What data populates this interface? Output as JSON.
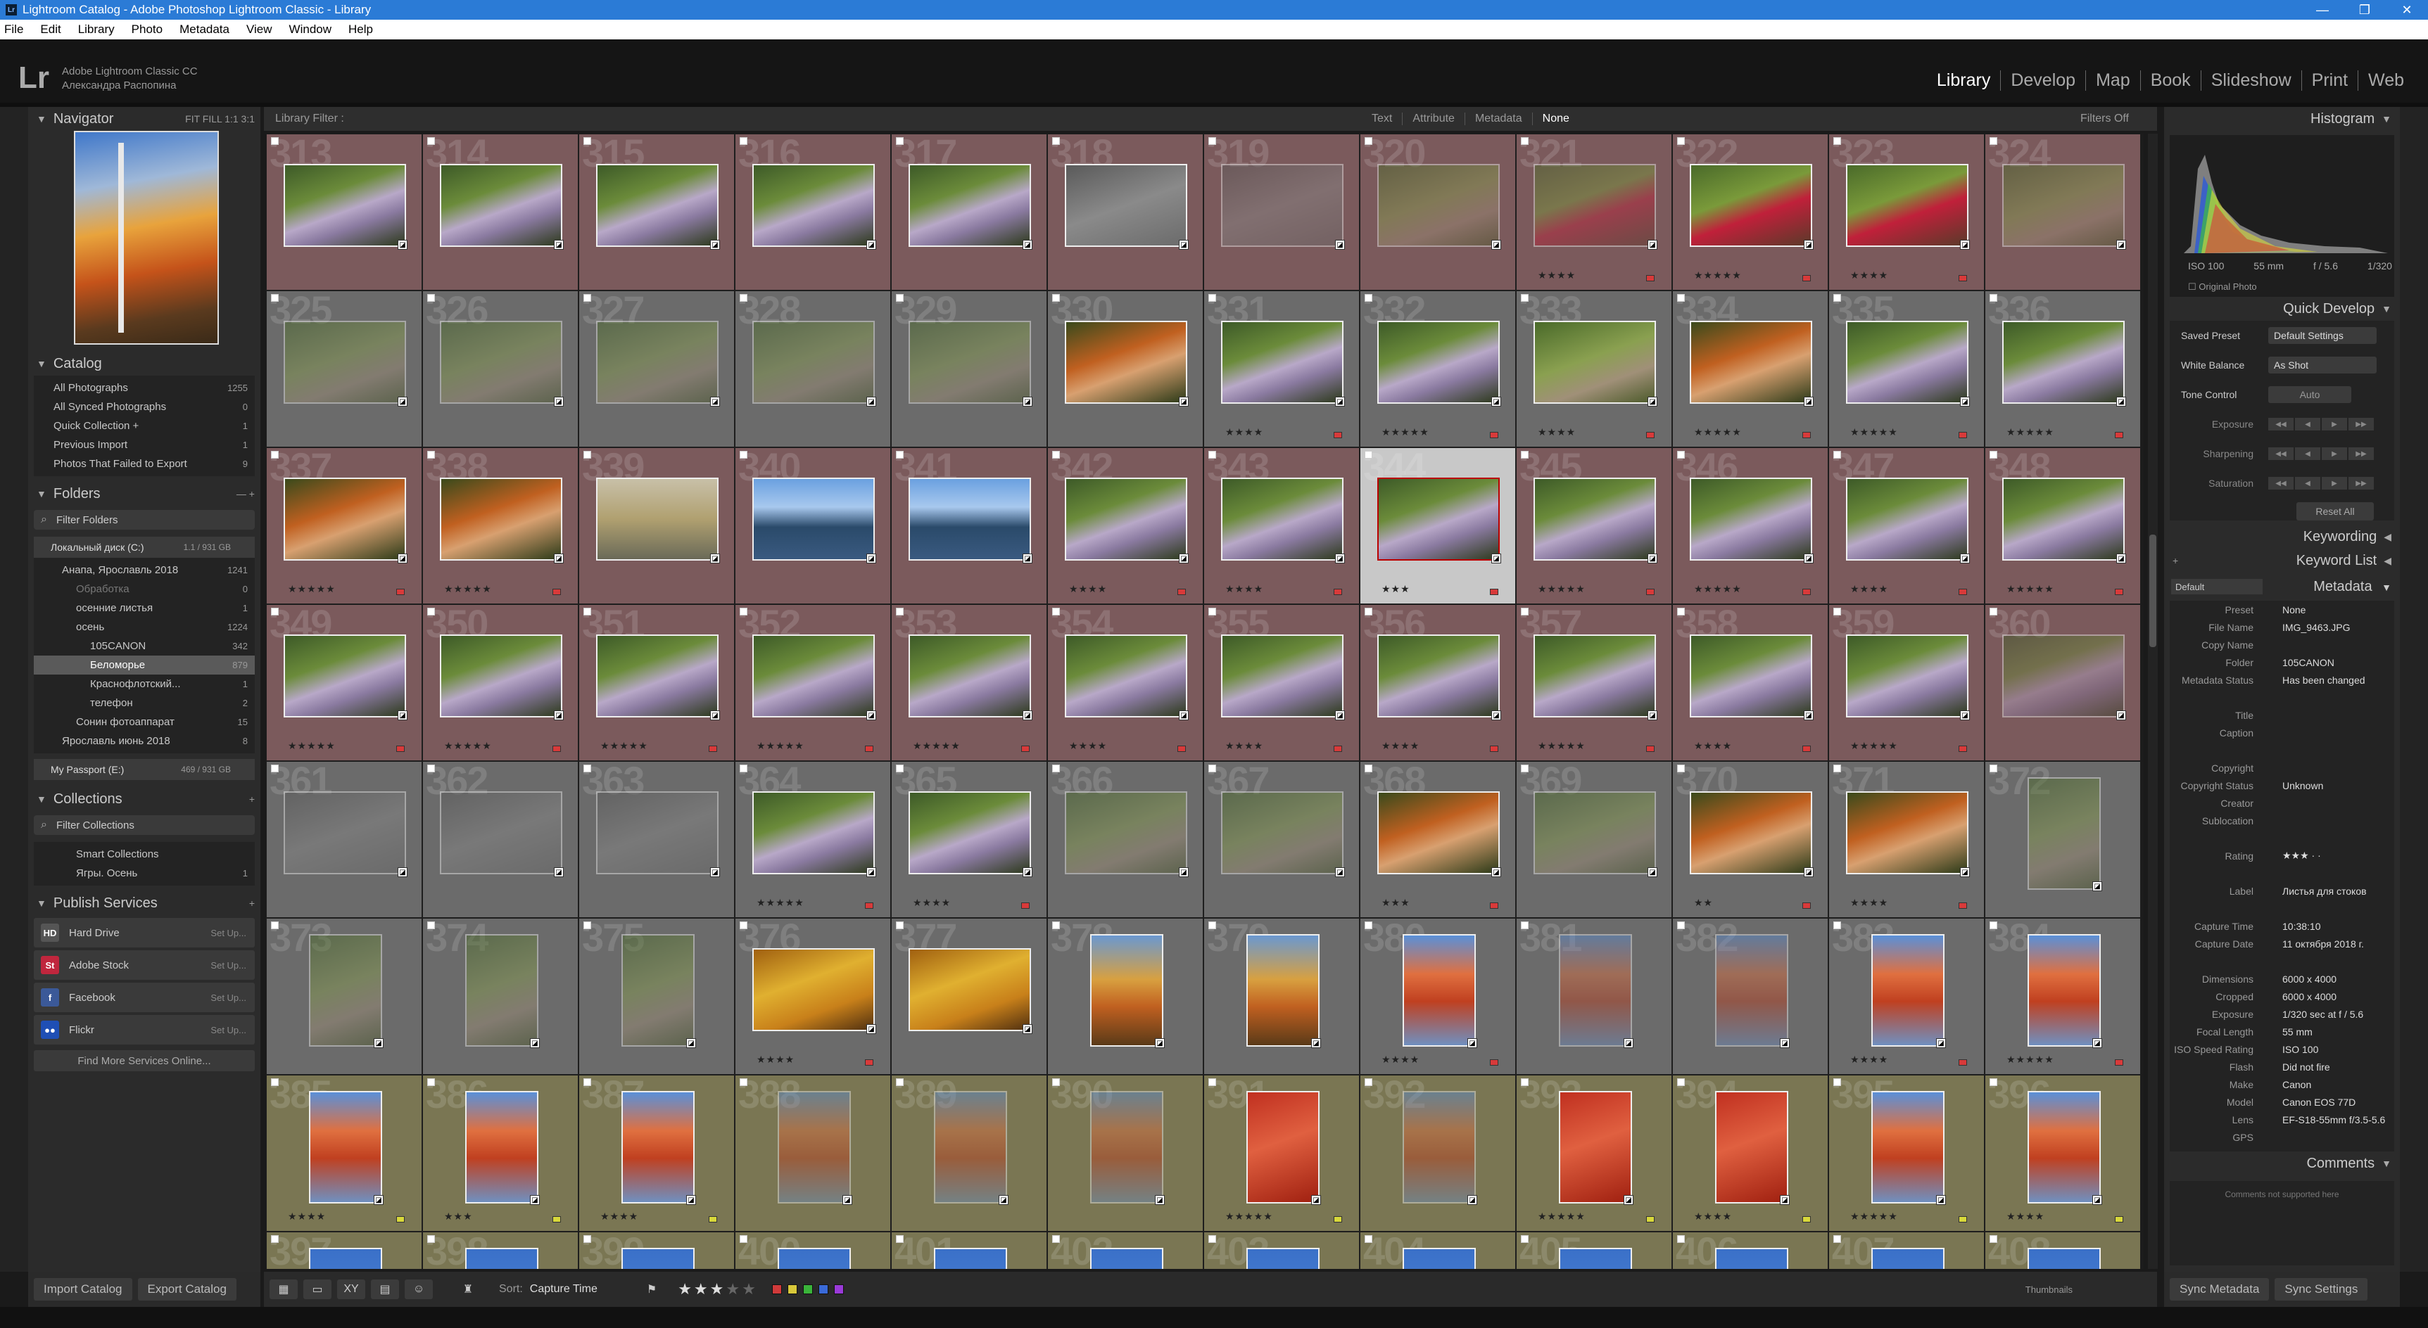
{
  "window": {
    "title": "Lightroom Catalog - Adobe Photoshop Lightroom Classic - Library"
  },
  "menu": [
    "File",
    "Edit",
    "Library",
    "Photo",
    "Metadata",
    "View",
    "Window",
    "Help"
  ],
  "identity": {
    "logo": "Lr",
    "product": "Adobe Lightroom Classic CC",
    "user": "Александра Распопина"
  },
  "modules": [
    "Library",
    "Develop",
    "Map",
    "Book",
    "Slideshow",
    "Print",
    "Web"
  ],
  "navigator": {
    "title": "Navigator",
    "zoom": "FIT  FILL  1:1  3:1"
  },
  "catalog": {
    "title": "Catalog",
    "items": [
      {
        "label": "All Photographs",
        "count": "1255"
      },
      {
        "label": "All Synced Photographs",
        "count": "0"
      },
      {
        "label": "Quick Collection +",
        "count": "1"
      },
      {
        "label": "Previous Import",
        "count": "1"
      },
      {
        "label": "Photos That Failed to Export",
        "count": "9"
      }
    ]
  },
  "folders": {
    "title": "Folders",
    "filter": "Filter Folders",
    "volume": {
      "label": "Локальный диск (C:)",
      "count": "1.1 / 931 GB"
    },
    "items": [
      {
        "label": "Анапа, Ярославль 2018",
        "count": "1241"
      },
      {
        "label": "Обработка",
        "count": "0"
      },
      {
        "label": "осенние листья",
        "count": "1"
      },
      {
        "label": "осень",
        "count": "1224"
      },
      {
        "label": "105CANON",
        "count": "342"
      },
      {
        "label": "Беломорье",
        "count": "879"
      },
      {
        "label": "Краснофлотский...",
        "count": "1"
      },
      {
        "label": "телефон",
        "count": "2"
      },
      {
        "label": "Сонин фотоаппарат",
        "count": "15"
      },
      {
        "label": "Ярославль июнь 2018",
        "count": "8"
      }
    ],
    "volume2": {
      "label": "My Passport (E:)",
      "count": "469 / 931 GB"
    }
  },
  "collections": {
    "title": "Collections",
    "filter": "Filter Collections",
    "items": [
      {
        "label": "Smart Collections",
        "count": ""
      },
      {
        "label": "Ягры. Осень",
        "count": "1"
      }
    ]
  },
  "publish": {
    "title": "Publish Services",
    "items": [
      {
        "label": "Hard Drive",
        "setup": "Set Up...",
        "icon": "HD",
        "color": "#555555"
      },
      {
        "label": "Adobe Stock",
        "setup": "Set Up...",
        "icon": "St",
        "color": "#c0263d"
      },
      {
        "label": "Facebook",
        "setup": "Set Up...",
        "icon": "f",
        "color": "#3b5998"
      },
      {
        "label": "Flickr",
        "setup": "Set Up...",
        "icon": "●●",
        "color": "#1f4fb5"
      }
    ],
    "findmore": "Find More Services Online..."
  },
  "filterbar": {
    "label": "Library Filter :",
    "tabs": [
      "Text",
      "Attribute",
      "Metadata",
      "None"
    ],
    "off": "Filters Off"
  },
  "grid": {
    "rows": [
      {
        "start": 313,
        "color": "#7b5a5c",
        "thumbs": [
          "violet",
          "violet",
          "violet",
          "violet",
          "violet",
          "grey",
          "grey",
          "green",
          "red",
          "red",
          "red",
          "green"
        ],
        "dim": [
          6,
          7,
          8,
          11
        ],
        "stars": [
          "",
          "",
          "",
          "",
          "",
          "",
          "",
          "",
          "★★★★",
          "★★★★★",
          "★★★★",
          ""
        ]
      },
      {
        "start": 325,
        "color": "#6b6b6b",
        "thumbs": [
          "green",
          "green",
          "green",
          "green",
          "green",
          "leaf",
          "violet",
          "violet",
          "green",
          "leaf",
          "violet",
          "violet"
        ],
        "dim": [
          0,
          1,
          2,
          3,
          4
        ],
        "stars": [
          "",
          "",
          "",
          "",
          "",
          "",
          "★★★★",
          "★★★★★",
          "★★★★",
          "★★★★★",
          "★★★★★",
          "★★★★★"
        ]
      },
      {
        "start": 337,
        "color": "#7b5a5c",
        "thumbs": [
          "leaf",
          "leaf",
          "birch",
          "lake",
          "lake",
          "violet",
          "violet",
          "violet",
          "violet",
          "violet",
          "violet",
          "violet"
        ],
        "dim": [],
        "stars": [
          "★★★★★",
          "★★★★★",
          "",
          "",
          "",
          "★★★★",
          "★★★★",
          "★★★",
          "★★★★★",
          "★★★★★",
          "★★★★",
          "★★★★★"
        ]
      },
      {
        "start": 349,
        "color": "#7b5a5c",
        "thumbs": [
          "violet",
          "violet",
          "violet",
          "violet",
          "violet",
          "violet",
          "violet",
          "violet",
          "violet",
          "violet",
          "violet",
          "violet"
        ],
        "dim": [
          11
        ],
        "stars": [
          "★★★★★",
          "★★★★★",
          "★★★★★",
          "★★★★★",
          "★★★★★",
          "★★★★",
          "★★★★",
          "★★★★",
          "★★★★★",
          "★★★★",
          "★★★★★",
          ""
        ]
      },
      {
        "start": 361,
        "color": "#6b6b6b",
        "thumbs": [
          "grey",
          "grey",
          "grey",
          "violet",
          "violet",
          "green",
          "green",
          "leaf",
          "green",
          "leaf",
          "leaf",
          "green"
        ],
        "dim": [
          0,
          1,
          2,
          5,
          6,
          8,
          11
        ],
        "stars": [
          "",
          "",
          "",
          "★★★★★",
          "★★★★",
          "",
          "",
          "★★★",
          "",
          "★★",
          "★★★★",
          ""
        ]
      },
      {
        "start": 373,
        "color": "#6b6b6b",
        "thumbs": [
          "green",
          "green",
          "green",
          "yellow",
          "yellow",
          "autumn",
          "autumn",
          "rowan",
          "rowan",
          "rowan",
          "rowan",
          "rowan"
        ],
        "dim": [
          0,
          1,
          2,
          8,
          9
        ],
        "stars": [
          "",
          "",
          "",
          "★★★★",
          "",
          "",
          "",
          "★★★★",
          "",
          "",
          "★★★★",
          "★★★★★"
        ]
      },
      {
        "start": 385,
        "color": "#7a7653",
        "thumbs": [
          "rowan",
          "rowan",
          "rowan",
          "rowan",
          "rowan",
          "rowan",
          "redleaf",
          "rowan",
          "redleaf",
          "redleaf",
          "rowan",
          "rowan"
        ],
        "dim": [
          3,
          4,
          5,
          7
        ],
        "stars": [
          "★★★★",
          "★★★",
          "★★★★",
          "",
          "",
          "",
          "★★★★★",
          "",
          "★★★★★",
          "★★★★",
          "★★★★★",
          "★★★★"
        ]
      },
      {
        "start": 397,
        "color": "#7a7653",
        "thumbs": [
          "blue",
          "blue",
          "blue",
          "blue",
          "blue",
          "blue",
          "blue",
          "blue",
          "blue",
          "blue",
          "blue",
          "blue"
        ],
        "dim": [],
        "stars": [
          "",
          "",
          "",
          "",
          "",
          "",
          "",
          "",
          "",
          "",
          "",
          ""
        ]
      }
    ],
    "selected": 344
  },
  "palette": {
    "violet": "linear-gradient(160deg,#3d5a28 0%,#6b8b3a 35%,#b8a8c8 55%,#8a7aa0 70%,#2d3a1c 100%)",
    "grey": "linear-gradient(160deg,#5a5a5a 0%,#8a8a8a 50%,#6b6b6b 100%)",
    "green": "linear-gradient(160deg,#4a6a2a 0%,#8aa050 45%,#a09078 70%,#4c5a2a 100%)",
    "red": "linear-gradient(160deg,#4a6a2a 0%,#7a9a3a 40%,#c0203a 60%,#5a3a2a 100%)",
    "leaf": "linear-gradient(160deg,#3a4a1c 0%,#c06020 40%,#d8a070 60%,#2c3a18 100%)",
    "birch": "linear-gradient(180deg,#c8c0a8 0%,#b0a070 50%,#6a6a58 100%)",
    "lake": "linear-gradient(180deg,#6aa0e0 0%,#a8c8ee 35%,#2a4a6a 60%,#3a5a80 100%)",
    "yellow": "linear-gradient(160deg,#a06010 0%,#e0b030 40%,#c8801a 70%,#503010 100%)",
    "autumn": "linear-gradient(180deg,#6a98d0 0%,#d8a040 40%,#c06020 65%,#5a3a18 100%)",
    "rowan": "linear-gradient(180deg,#5a90d8 0%,#e07040 35%,#c04020 60%,#7090c0 100%)",
    "redleaf": "linear-gradient(160deg,#c03020 0%,#e06040 45%,#a02010 100%)",
    "blue": "linear-gradient(180deg,#3a70c8 0%,#5a90e0 100%)"
  },
  "histogram": {
    "title": "Histogram",
    "iso": "ISO 100",
    "focal": "55 mm",
    "aperture": "f / 5.6",
    "shutter": "1/320",
    "original": "Original Photo"
  },
  "quickdevelop": {
    "title": "Quick Develop",
    "saved_preset": {
      "label": "Saved Preset",
      "value": "Default Settings"
    },
    "white_balance": {
      "label": "White Balance",
      "value": "As Shot"
    },
    "tone_control": {
      "label": "Tone Control",
      "value": "Auto"
    },
    "exposure": "Exposure",
    "sharpening": "Sharpening",
    "saturation": "Saturation",
    "reset": "Reset All"
  },
  "keywording": "Keywording",
  "keywordlist": "Keyword List",
  "metadata": {
    "title": "Metadata",
    "preset_dd": "Default",
    "rows": [
      {
        "k": "Preset",
        "v": "None"
      },
      {
        "k": "File Name",
        "v": "IMG_9463.JPG"
      },
      {
        "k": "Copy Name",
        "v": ""
      },
      {
        "k": "Folder",
        "v": "105CANON"
      },
      {
        "k": "Metadata Status",
        "v": "Has been changed"
      },
      {
        "k": "",
        "v": ""
      },
      {
        "k": "Title",
        "v": ""
      },
      {
        "k": "Caption",
        "v": ""
      },
      {
        "k": "",
        "v": ""
      },
      {
        "k": "Copyright",
        "v": ""
      },
      {
        "k": "Copyright Status",
        "v": "Unknown"
      },
      {
        "k": "Creator",
        "v": ""
      },
      {
        "k": "Sublocation",
        "v": ""
      },
      {
        "k": "",
        "v": ""
      },
      {
        "k": "Rating",
        "v": "★★★ · ·"
      },
      {
        "k": "",
        "v": ""
      },
      {
        "k": "Label",
        "v": "Листья для стоков"
      },
      {
        "k": "",
        "v": ""
      },
      {
        "k": "Capture Time",
        "v": "10:38:10"
      },
      {
        "k": "Capture Date",
        "v": "11 октября 2018 г."
      },
      {
        "k": "",
        "v": ""
      },
      {
        "k": "Dimensions",
        "v": "6000 x 4000"
      },
      {
        "k": "Cropped",
        "v": "6000 x 4000"
      },
      {
        "k": "Exposure",
        "v": "1/320 sec at f / 5.6"
      },
      {
        "k": "Focal Length",
        "v": "55 mm"
      },
      {
        "k": "ISO Speed Rating",
        "v": "ISO 100"
      },
      {
        "k": "Flash",
        "v": "Did not fire"
      },
      {
        "k": "Make",
        "v": "Canon"
      },
      {
        "k": "Model",
        "v": "Canon EOS 77D"
      },
      {
        "k": "Lens",
        "v": "EF-S18-55mm f/3.5-5.6"
      },
      {
        "k": "GPS",
        "v": ""
      }
    ]
  },
  "comments": {
    "title": "Comments",
    "note": "Comments not supported here"
  },
  "toolbar": {
    "sort_label": "Sort:",
    "sort_value": "Capture Time",
    "thumbnails": "Thumbnails"
  },
  "bottom": {
    "import": "Import Catalog",
    "export": "Export Catalog",
    "sync_meta": "Sync Metadata",
    "sync_settings": "Sync Settings"
  }
}
